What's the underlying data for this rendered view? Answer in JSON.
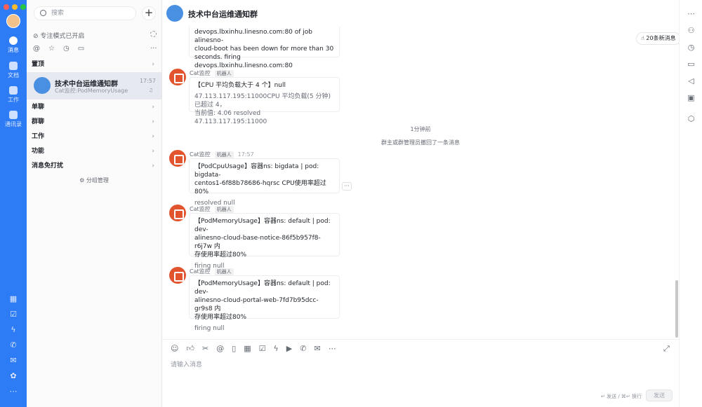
{
  "sidebar": {
    "search_placeholder": "搜索",
    "add": "+",
    "focus_mode": "专注模式已开启",
    "tools": [
      "@",
      "☆",
      "◷",
      "▭"
    ],
    "more": "···",
    "sections": [
      {
        "label": "置顶"
      },
      {
        "label": "单聊"
      },
      {
        "label": "群聊"
      },
      {
        "label": "工作"
      },
      {
        "label": "功能"
      },
      {
        "label": "消息免打扰"
      }
    ],
    "pinned_chat": {
      "name": "技术中台运维通知群",
      "preview": "Cat监控:PodMemoryUsage",
      "time": "17:57"
    },
    "group_manage": "分组管理"
  },
  "rail": {
    "items": [
      {
        "label": "消息"
      },
      {
        "label": "文档"
      },
      {
        "label": "工作"
      },
      {
        "label": "通讯录"
      }
    ]
  },
  "header": {
    "title": "技术中台运维通知群"
  },
  "new_messages": "20条新消息",
  "messages": [
    {
      "lines": [
        "devops.lbxinhu.linesno.com:80 of job alinesno-",
        "cloud-boot has been down for more than 30",
        "seconds. firing devops.lbxinhu.linesno.com:80"
      ]
    },
    {
      "sender": "Cat监控",
      "badge": "机器人",
      "title": "【CPU 平均负载大于 4 个】null",
      "lines": [
        "47.113.117.195:11000CPU 平均负载(5 分钟) 已超过 4，",
        "当前值: 4.06 resolved 47.113.117.195:11000"
      ]
    },
    {
      "sender": "Cat监控",
      "badge": "机器人",
      "time": "17:57",
      "title1": "【PodCpuUsage】容器ns: bigdata | pod: bigdata-",
      "title2": "centos1-6f88b78686-hqrsc CPU使用率超过80%",
      "sub": "resolved null"
    },
    {
      "sender": "Cat监控",
      "badge": "机器人",
      "title1": "【PodMemoryUsage】容器ns: default | pod: dev-",
      "title2": "alinesno-cloud-base-notice-86f5b957f8-r6j7w 内",
      "title3": "存使用率超过80%",
      "sub": "firing null"
    },
    {
      "sender": "Cat监控",
      "badge": "机器人",
      "title1": "【PodMemoryUsage】容器ns: default | pod: dev-",
      "title2": "alinesno-cloud-portal-web-7fd7b95dcc-gr9s8 内",
      "title3": "存使用率超过80%",
      "sub": "firing null"
    }
  ],
  "time_divider": "1分钟前",
  "recall_note": "群主或群管理员撤回了一条消息",
  "composer": {
    "placeholder": "请输入消息",
    "hint": "↵ 发送 / ⌘↵ 换行",
    "send": "发送"
  }
}
